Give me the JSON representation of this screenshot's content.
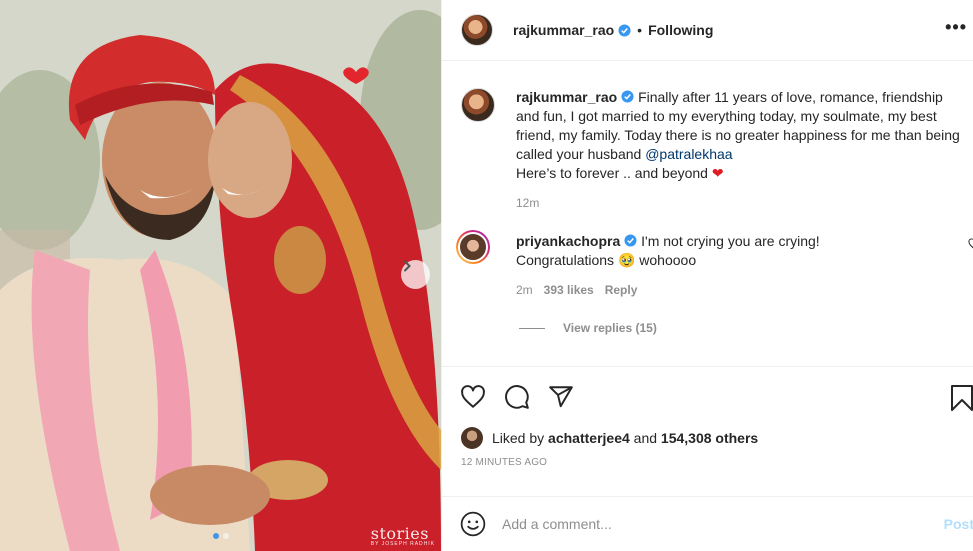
{
  "post": {
    "author": "rajkummar_rao",
    "separator": "•",
    "follow_status": "Following",
    "more_label": "•••",
    "image_watermark": "stories",
    "image_watermark_sub": "BY JOSEPH RADHIK",
    "carousel": {
      "total": 2,
      "current": 1
    }
  },
  "caption": {
    "username": "rajkummar_rao",
    "text": "Finally after 11 years of love, romance, friendship and fun, I got married to my everything today, my soulmate, my best friend, my family. Today there is no greater happiness for me than being called your husband ",
    "mention": "@patralekhaa",
    "text2": "Here’s to forever .. and beyond ",
    "emoji": "❤",
    "time": "12m"
  },
  "top_comment": {
    "username": "priyankachopra",
    "text_line1": "I'm not crying you are crying!",
    "text_line2_prefix": "Congratulations ",
    "emoji": "🥹",
    "text_line2_suffix": " wohoooo",
    "time": "2m",
    "likes": "393 likes",
    "reply_label": "Reply",
    "view_replies": "View replies (15)"
  },
  "actions": {
    "liked_by_prefix": "Liked by ",
    "liked_by_user": "achatterjee4",
    "liked_by_mid": " and ",
    "liked_by_count": "154,308 others",
    "time_ago": "12 MINUTES AGO"
  },
  "add_comment": {
    "placeholder": "Add a comment...",
    "post_label": "Post"
  },
  "colors": {
    "verified": "#3897f0",
    "mention": "#00376b",
    "post_disabled": "#b2dffc",
    "carousel_active": "#3d97e9"
  },
  "icons": [
    "heart-icon",
    "comment-icon",
    "share-icon",
    "bookmark-icon",
    "emoji-icon",
    "chevron-right-icon",
    "verified-badge-icon"
  ]
}
